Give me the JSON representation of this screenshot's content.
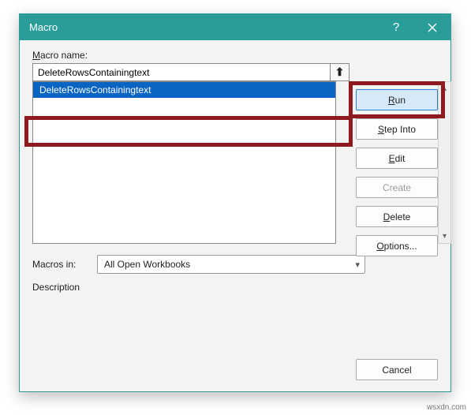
{
  "window": {
    "title": "Macro"
  },
  "labels": {
    "macro_name_prefix": "M",
    "macro_name_rest": "acro name:",
    "macros_in": "Macros in:",
    "description": "Description"
  },
  "fields": {
    "macro_name_value": "DeleteRowsContainingtext",
    "macros_in_value": "All Open Workbooks"
  },
  "list": {
    "items": [
      "DeleteRowsContainingtext"
    ]
  },
  "buttons": {
    "run": "Run",
    "step_into": "Step Into",
    "edit": "Edit",
    "create": "Create",
    "delete": "Delete",
    "options": "Options...",
    "cancel": "Cancel"
  },
  "watermark": "wsxdn.com"
}
